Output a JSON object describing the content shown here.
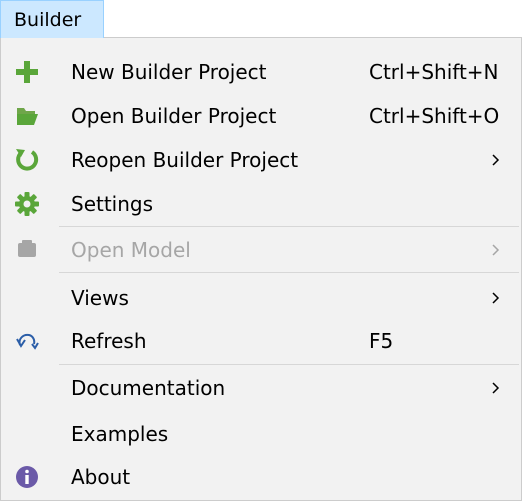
{
  "menubar": {
    "title": "Builder"
  },
  "menu": {
    "items": [
      {
        "label": "New Builder Project",
        "shortcut": "Ctrl+Shift+N",
        "icon": "plus-icon"
      },
      {
        "label": "Open Builder Project",
        "shortcut": "Ctrl+Shift+O",
        "icon": "folder-open-icon"
      },
      {
        "label": "Reopen Builder Project",
        "icon": "reopen-icon",
        "submenu": true
      },
      {
        "label": "Settings",
        "icon": "gear-icon"
      },
      {
        "label": "Open Model",
        "icon": "model-icon",
        "submenu": true,
        "disabled": true
      },
      {
        "label": "Views",
        "submenu": true
      },
      {
        "label": "Refresh",
        "shortcut": "F5",
        "icon": "refresh-icon"
      },
      {
        "label": "Documentation",
        "submenu": true
      },
      {
        "label": "Examples"
      },
      {
        "label": "About",
        "icon": "info-icon"
      }
    ]
  },
  "colors": {
    "menubar_highlight": "#cce8ff",
    "menu_background": "#f2f2f2",
    "icon_green": "#5aa63a",
    "disabled_text": "#a6a6a6",
    "info_purple": "#6b5aa8"
  }
}
